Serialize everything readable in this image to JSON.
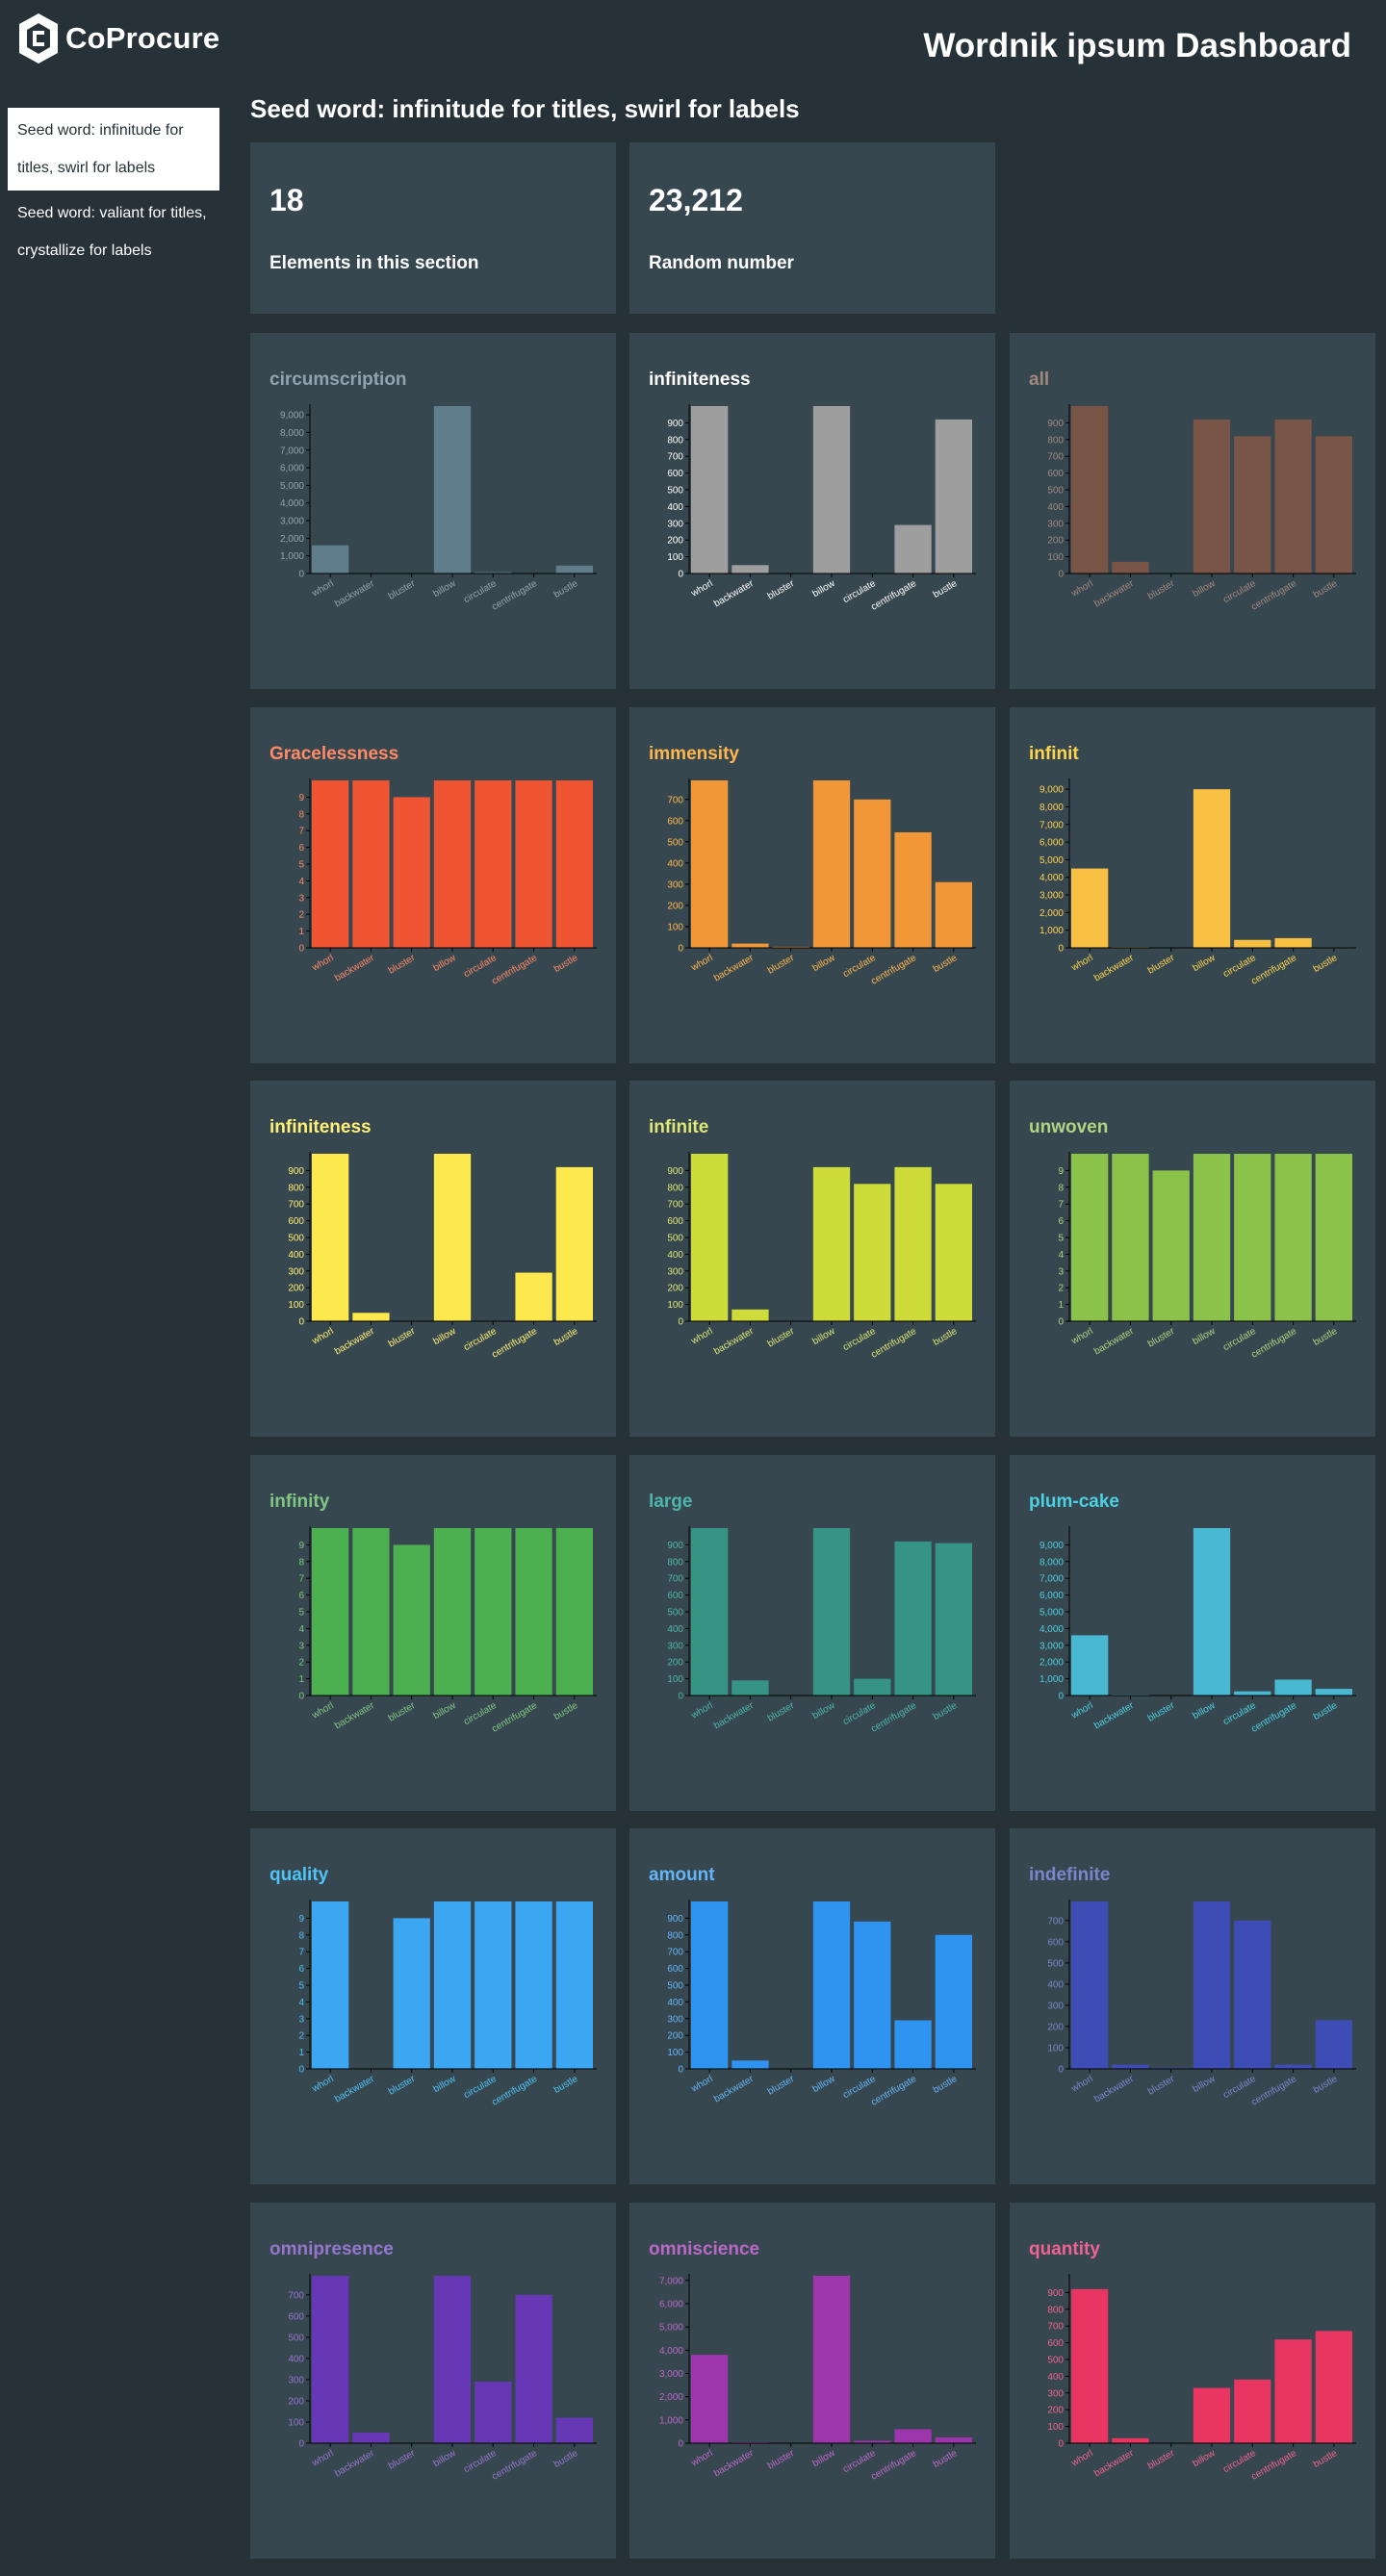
{
  "logo": {
    "text": "CoProcure"
  },
  "header": {
    "title": "Wordnik ipsum Dashboard"
  },
  "sidebar": {
    "items": [
      {
        "label": "Seed word: infinitude for titles, swirl for labels",
        "active": true
      },
      {
        "label": "Seed word: valiant for titles, crystallize for labels",
        "active": false
      }
    ]
  },
  "section": {
    "title": "Seed word: infinitude for titles, swirl for labels"
  },
  "stats": [
    {
      "value": "18",
      "label": "Elements in this section"
    },
    {
      "value": "23,212",
      "label": "Random number"
    }
  ],
  "chart_data": [
    {
      "type": "bar",
      "title": "circumscription",
      "color": "#607d8b",
      "label_color": "#90a4ae",
      "categories": [
        "whorl",
        "backwater",
        "bluster",
        "billow",
        "circulate",
        "centrifugate",
        "bustle"
      ],
      "values": [
        1600,
        20,
        10,
        9500,
        80,
        20,
        450
      ],
      "ylim": [
        0,
        9500
      ],
      "yticks": [
        0,
        1000,
        2000,
        3000,
        4000,
        5000,
        6000,
        7000,
        8000,
        9000
      ],
      "ytick_labels": [
        "0",
        "1,000",
        "2,000",
        "3,000",
        "4,000",
        "5,000",
        "6,000",
        "7,000",
        "8,000",
        "9,000"
      ]
    },
    {
      "type": "bar",
      "title": "infiniteness",
      "color": "#9e9e9e",
      "label_color": "#ffffff",
      "categories": [
        "whorl",
        "backwater",
        "bluster",
        "billow",
        "circulate",
        "centrifugate",
        "bustle"
      ],
      "values": [
        1000,
        50,
        0,
        1000,
        0,
        290,
        920
      ],
      "ylim": [
        0,
        1000
      ],
      "yticks": [
        0,
        100,
        200,
        300,
        400,
        500,
        600,
        700,
        800,
        900
      ],
      "ytick_labels": [
        "0",
        "100",
        "200",
        "300",
        "400",
        "500",
        "600",
        "700",
        "800",
        "900"
      ]
    },
    {
      "type": "bar",
      "title": "all",
      "color": "#795548",
      "label_color": "#a1887f",
      "categories": [
        "whorl",
        "backwater",
        "bluster",
        "billow",
        "circulate",
        "centrifugate",
        "bustle"
      ],
      "values": [
        1000,
        70,
        0,
        920,
        820,
        920,
        820
      ],
      "ylim": [
        0,
        1000
      ],
      "yticks": [
        0,
        100,
        200,
        300,
        400,
        500,
        600,
        700,
        800,
        900
      ],
      "ytick_labels": [
        "0",
        "100",
        "200",
        "300",
        "400",
        "500",
        "600",
        "700",
        "800",
        "900"
      ]
    },
    {
      "type": "bar",
      "title": "Gracelessness",
      "color": "#f05533",
      "label_color": "#ff8a65",
      "categories": [
        "whorl",
        "backwater",
        "bluster",
        "billow",
        "circulate",
        "centrifugate",
        "bustle"
      ],
      "values": [
        10,
        10,
        9,
        10,
        10,
        10,
        10
      ],
      "ylim": [
        0,
        10
      ],
      "yticks": [
        0,
        1,
        2,
        3,
        4,
        5,
        6,
        7,
        8,
        9
      ],
      "ytick_labels": [
        "0",
        "1",
        "2",
        "3",
        "4",
        "5",
        "6",
        "7",
        "8",
        "9"
      ]
    },
    {
      "type": "bar",
      "title": "immensity",
      "color": "#f19737",
      "label_color": "#ffb74d",
      "categories": [
        "whorl",
        "backwater",
        "bluster",
        "billow",
        "circulate",
        "centrifugate",
        "bustle"
      ],
      "values": [
        790,
        20,
        5,
        790,
        700,
        545,
        310
      ],
      "ylim": [
        0,
        790
      ],
      "yticks": [
        0,
        100,
        200,
        300,
        400,
        500,
        600,
        700
      ],
      "ytick_labels": [
        "0",
        "100",
        "200",
        "300",
        "400",
        "500",
        "600",
        "700"
      ]
    },
    {
      "type": "bar",
      "title": "infinit",
      "color": "#f7c043",
      "label_color": "#ffd54f",
      "categories": [
        "whorl",
        "backwater",
        "bluster",
        "billow",
        "circulate",
        "centrifugate",
        "bustle"
      ],
      "values": [
        4500,
        40,
        0,
        9000,
        450,
        550,
        30
      ],
      "ylim": [
        0,
        9500
      ],
      "yticks": [
        0,
        1000,
        2000,
        3000,
        4000,
        5000,
        6000,
        7000,
        8000,
        9000
      ],
      "ytick_labels": [
        "0",
        "1,000",
        "2,000",
        "3,000",
        "4,000",
        "5,000",
        "6,000",
        "7,000",
        "8,000",
        "9,000"
      ]
    },
    {
      "type": "bar",
      "title": "infiniteness",
      "color": "#fde84d",
      "label_color": "#fff176",
      "categories": [
        "whorl",
        "backwater",
        "bluster",
        "billow",
        "circulate",
        "centrifugate",
        "bustle"
      ],
      "values": [
        1000,
        50,
        0,
        1000,
        0,
        290,
        920
      ],
      "ylim": [
        0,
        1000
      ],
      "yticks": [
        0,
        100,
        200,
        300,
        400,
        500,
        600,
        700,
        800,
        900
      ],
      "ytick_labels": [
        "0",
        "100",
        "200",
        "300",
        "400",
        "500",
        "600",
        "700",
        "800",
        "900"
      ]
    },
    {
      "type": "bar",
      "title": "infinite",
      "color": "#cddc39",
      "label_color": "#dce775",
      "categories": [
        "whorl",
        "backwater",
        "bluster",
        "billow",
        "circulate",
        "centrifugate",
        "bustle"
      ],
      "values": [
        1000,
        70,
        0,
        920,
        820,
        920,
        820
      ],
      "ylim": [
        0,
        1000
      ],
      "yticks": [
        0,
        100,
        200,
        300,
        400,
        500,
        600,
        700,
        800,
        900
      ],
      "ytick_labels": [
        "0",
        "100",
        "200",
        "300",
        "400",
        "500",
        "600",
        "700",
        "800",
        "900"
      ]
    },
    {
      "type": "bar",
      "title": "unwoven",
      "color": "#8bc34a",
      "label_color": "#aed581",
      "categories": [
        "whorl",
        "backwater",
        "bluster",
        "billow",
        "circulate",
        "centrifugate",
        "bustle"
      ],
      "values": [
        10,
        10,
        9,
        10,
        10,
        10,
        10
      ],
      "ylim": [
        0,
        10
      ],
      "yticks": [
        0,
        1,
        2,
        3,
        4,
        5,
        6,
        7,
        8,
        9
      ],
      "ytick_labels": [
        "0",
        "1",
        "2",
        "3",
        "4",
        "5",
        "6",
        "7",
        "8",
        "9"
      ]
    },
    {
      "type": "bar",
      "title": "infinity",
      "color": "#4caf50",
      "label_color": "#81c784",
      "categories": [
        "whorl",
        "backwater",
        "bluster",
        "billow",
        "circulate",
        "centrifugate",
        "bustle"
      ],
      "values": [
        10,
        10,
        9,
        10,
        10,
        10,
        10
      ],
      "ylim": [
        0,
        10
      ],
      "yticks": [
        0,
        1,
        2,
        3,
        4,
        5,
        6,
        7,
        8,
        9
      ],
      "ytick_labels": [
        "0",
        "1",
        "2",
        "3",
        "4",
        "5",
        "6",
        "7",
        "8",
        "9"
      ]
    },
    {
      "type": "bar",
      "title": "large",
      "color": "#359483",
      "label_color": "#4db6ac",
      "categories": [
        "whorl",
        "backwater",
        "bluster",
        "billow",
        "circulate",
        "centrifugate",
        "bustle"
      ],
      "values": [
        1000,
        90,
        0,
        1000,
        100,
        920,
        910
      ],
      "ylim": [
        0,
        1000
      ],
      "yticks": [
        0,
        100,
        200,
        300,
        400,
        500,
        600,
        700,
        800,
        900
      ],
      "ytick_labels": [
        "0",
        "100",
        "200",
        "300",
        "400",
        "500",
        "600",
        "700",
        "800",
        "900"
      ]
    },
    {
      "type": "bar",
      "title": "plum-cake",
      "color": "#49b8d3",
      "label_color": "#4dd0e1",
      "categories": [
        "whorl",
        "backwater",
        "bluster",
        "billow",
        "circulate",
        "centrifugate",
        "bustle"
      ],
      "values": [
        3600,
        50,
        0,
        10000,
        250,
        950,
        400
      ],
      "ylim": [
        0,
        10000
      ],
      "yticks": [
        0,
        1000,
        2000,
        3000,
        4000,
        5000,
        6000,
        7000,
        8000,
        9000
      ],
      "ytick_labels": [
        "0",
        "1,000",
        "2,000",
        "3,000",
        "4,000",
        "5,000",
        "6,000",
        "7,000",
        "8,000",
        "9,000"
      ]
    },
    {
      "type": "bar",
      "title": "quality",
      "color": "#3ba7f3",
      "label_color": "#4fc3f7",
      "categories": [
        "whorl",
        "backwater",
        "bluster",
        "billow",
        "circulate",
        "centrifugate",
        "bustle"
      ],
      "values": [
        10,
        0,
        9,
        10,
        10,
        10,
        10
      ],
      "ylim": [
        0,
        10
      ],
      "yticks": [
        0,
        1,
        2,
        3,
        4,
        5,
        6,
        7,
        8,
        9
      ],
      "ytick_labels": [
        "0",
        "1",
        "2",
        "3",
        "4",
        "5",
        "6",
        "7",
        "8",
        "9"
      ]
    },
    {
      "type": "bar",
      "title": "amount",
      "color": "#2f93f0",
      "label_color": "#64b5f6",
      "categories": [
        "whorl",
        "backwater",
        "bluster",
        "billow",
        "circulate",
        "centrifugate",
        "bustle"
      ],
      "values": [
        1000,
        50,
        0,
        1000,
        880,
        290,
        800
      ],
      "ylim": [
        0,
        1000
      ],
      "yticks": [
        0,
        100,
        200,
        300,
        400,
        500,
        600,
        700,
        800,
        900
      ],
      "ytick_labels": [
        "0",
        "100",
        "200",
        "300",
        "400",
        "500",
        "600",
        "700",
        "800",
        "900"
      ]
    },
    {
      "type": "bar",
      "title": "indefinite",
      "color": "#3e4db5",
      "label_color": "#7986cb",
      "categories": [
        "whorl",
        "backwater",
        "bluster",
        "billow",
        "circulate",
        "centrifugate",
        "bustle"
      ],
      "values": [
        790,
        20,
        5,
        790,
        700,
        20,
        230
      ],
      "ylim": [
        0,
        790
      ],
      "yticks": [
        0,
        100,
        200,
        300,
        400,
        500,
        600,
        700
      ],
      "ytick_labels": [
        "0",
        "100",
        "200",
        "300",
        "400",
        "500",
        "600",
        "700"
      ]
    },
    {
      "type": "bar",
      "title": "omnipresence",
      "color": "#6738b5",
      "label_color": "#9575cd",
      "categories": [
        "whorl",
        "backwater",
        "bluster",
        "billow",
        "circulate",
        "centrifugate",
        "bustle"
      ],
      "values": [
        790,
        50,
        0,
        790,
        290,
        700,
        120
      ],
      "ylim": [
        0,
        790
      ],
      "yticks": [
        0,
        100,
        200,
        300,
        400,
        500,
        600,
        700
      ],
      "ytick_labels": [
        "0",
        "100",
        "200",
        "300",
        "400",
        "500",
        "600",
        "700"
      ]
    },
    {
      "type": "bar",
      "title": "omniscience",
      "color": "#9d36ad",
      "label_color": "#ba68c8",
      "categories": [
        "whorl",
        "backwater",
        "bluster",
        "billow",
        "circulate",
        "centrifugate",
        "bustle"
      ],
      "values": [
        3800,
        40,
        0,
        7200,
        100,
        600,
        250
      ],
      "ylim": [
        0,
        7200
      ],
      "yticks": [
        0,
        1000,
        2000,
        3000,
        4000,
        5000,
        6000,
        7000
      ],
      "ytick_labels": [
        "0",
        "1,000",
        "2,000",
        "3,000",
        "4,000",
        "5,000",
        "6,000",
        "7,000"
      ]
    },
    {
      "type": "bar",
      "title": "quantity",
      "color": "#e83562",
      "label_color": "#f06292",
      "categories": [
        "whorl",
        "backwater",
        "bluster",
        "billow",
        "circulate",
        "centrifugate",
        "bustle"
      ],
      "values": [
        920,
        30,
        0,
        330,
        380,
        620,
        670
      ],
      "ylim": [
        0,
        1000
      ],
      "yticks": [
        0,
        100,
        200,
        300,
        400,
        500,
        600,
        700,
        800,
        900
      ],
      "ytick_labels": [
        "0",
        "100",
        "200",
        "300",
        "400",
        "500",
        "600",
        "700",
        "800",
        "900"
      ]
    }
  ]
}
